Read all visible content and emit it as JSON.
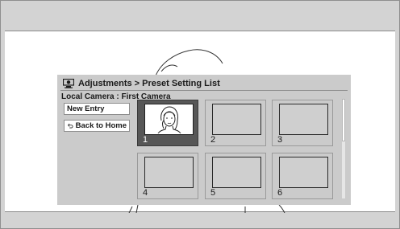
{
  "screen": {
    "title": "Adjustments > Preset Setting List",
    "source_label": "Local Camera : First Camera",
    "title_icon": "camera-icon"
  },
  "buttons": {
    "new_entry": "New Entry",
    "back_to_home": "Back to Home",
    "back_icon": "return-arrow-icon"
  },
  "presets": [
    {
      "number": "1",
      "has_image": true,
      "selected": true
    },
    {
      "number": "2",
      "has_image": false,
      "selected": false
    },
    {
      "number": "3",
      "has_image": false,
      "selected": false
    },
    {
      "number": "4",
      "has_image": false,
      "selected": false
    },
    {
      "number": "5",
      "has_image": false,
      "selected": false
    },
    {
      "number": "6",
      "has_image": false,
      "selected": false
    }
  ],
  "colors": {
    "frame": "#d3d3d3",
    "panel": "#cbcbcb",
    "selected_tile": "#575757"
  }
}
